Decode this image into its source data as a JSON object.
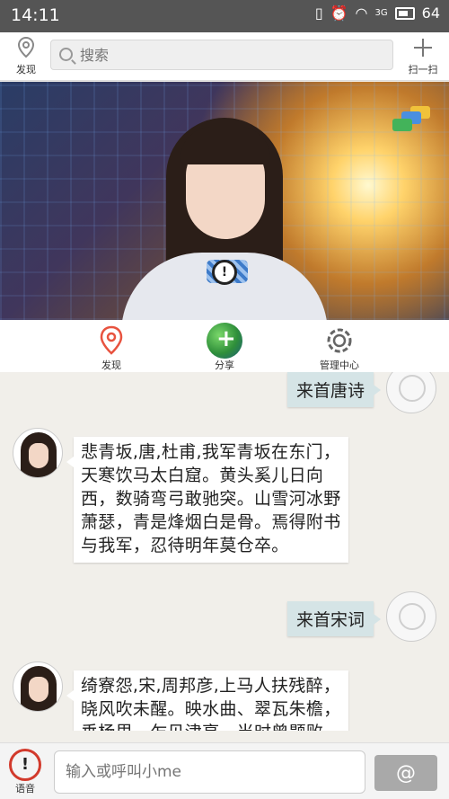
{
  "status_bar": {
    "time": "14:11",
    "battery": "64",
    "network": "3G"
  },
  "topbar": {
    "left_label": "发现",
    "search_placeholder": "搜索",
    "right_label": "扫一扫"
  },
  "nav": {
    "tabs": [
      {
        "label": "发现",
        "icon": "location-pin-icon",
        "color": "#e8533f"
      },
      {
        "label": "分享",
        "icon": "globe-share-icon"
      },
      {
        "label": "管理中心",
        "icon": "gear-icon"
      }
    ]
  },
  "chat": {
    "messages": [
      {
        "from": "user",
        "text": "来首唐诗"
      },
      {
        "from": "bot",
        "text": "悲青坂,唐,杜甫,我军青坂在东门，天寒饮马太白窟。黄头奚儿日向西，数骑弯弓敢驰突。山雪河冰野萧瑟，青是烽烟白是骨。焉得附书与我军，忍待明年莫仓卒。"
      },
      {
        "from": "user",
        "text": "来首宋词"
      },
      {
        "from": "bot",
        "text": "绮寮怨,宋,周邦彦,上马人扶残醉，晓风吹未醒。映水曲、翠瓦朱檐，垂杨里、乍见津亭。当时曾题败"
      }
    ]
  },
  "bottombar": {
    "voice_label": "语音",
    "input_placeholder": "输入或呼叫小me",
    "at_label": "@"
  },
  "colors": {
    "accent": "#e8533f",
    "status_bar": "#555555",
    "user_bubble": "#d5e4e6"
  }
}
